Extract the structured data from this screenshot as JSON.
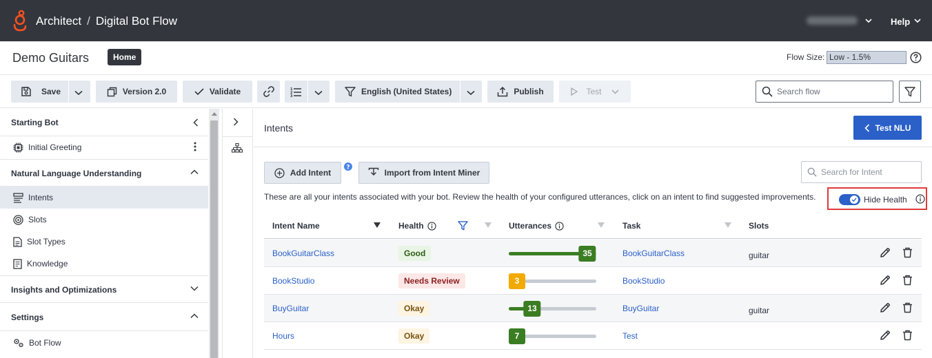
{
  "topbar": {
    "app": "Architect",
    "separator": "/",
    "flow_type": "Digital Bot Flow",
    "help_label": "Help"
  },
  "header": {
    "bot_name": "Demo Guitars",
    "home_badge": "Home",
    "flow_size_label": "Flow Size:",
    "flow_size_value": "Low - 1.5%"
  },
  "toolbar": {
    "save": "Save",
    "version": "Version 2.0",
    "validate": "Validate",
    "language": "English (United States)",
    "publish": "Publish",
    "test": "Test",
    "search_placeholder": "Search flow"
  },
  "leftnav": {
    "starting_bot": "Starting Bot",
    "initial_greeting": "Initial Greeting",
    "nlu": "Natural Language Understanding",
    "nlu_items": [
      "Intents",
      "Slots",
      "Slot Types",
      "Knowledge"
    ],
    "insights": "Insights and Optimizations",
    "settings": "Settings",
    "bot_flow": "Bot Flow"
  },
  "main": {
    "title": "Intents",
    "test_nlu": "Test NLU",
    "add_intent": "Add Intent",
    "import_intent": "Import from Intent Miner",
    "search_placeholder": "Search for Intent",
    "description": "These are all your intents associated with your bot. Review the health of your configured utterances, click on an intent to find suggested improvements.",
    "hide_health": "Hide Health",
    "hide_health_on": true
  },
  "table": {
    "headers": {
      "name": "Intent Name",
      "health": "Health",
      "utterances": "Utterances",
      "task": "Task",
      "slots": "Slots"
    },
    "utterance_scale_max": 35,
    "rows": [
      {
        "name": "BookGuitarClass",
        "health": "Good",
        "health_level": "good",
        "utterances": "35",
        "utterance_value": 35,
        "bar_color": "#3b7d23",
        "task": "BookGuitarClass",
        "slots": "guitar"
      },
      {
        "name": "BookStudio",
        "health": "Needs Review",
        "health_level": "review",
        "utterances": "3",
        "utterance_value": 3,
        "bar_color": "#f2a900",
        "task": "BookStudio",
        "slots": ""
      },
      {
        "name": "BuyGuitar",
        "health": "Okay",
        "health_level": "okay",
        "utterances": "13",
        "utterance_value": 13,
        "bar_color": "#3b7d23",
        "task": "BuyGuitar",
        "slots": "guitar"
      },
      {
        "name": "Hours",
        "health": "Okay",
        "health_level": "okay",
        "utterances": "7",
        "utterance_value": 7,
        "bar_color": "#3b7d23",
        "task": "Test",
        "slots": ""
      }
    ]
  },
  "colors": {
    "topbar_bg": "#33373d",
    "accent_blue": "#2a60c8",
    "logo_orange": "#ff4f1f",
    "highlight_red": "#e03a3a"
  }
}
